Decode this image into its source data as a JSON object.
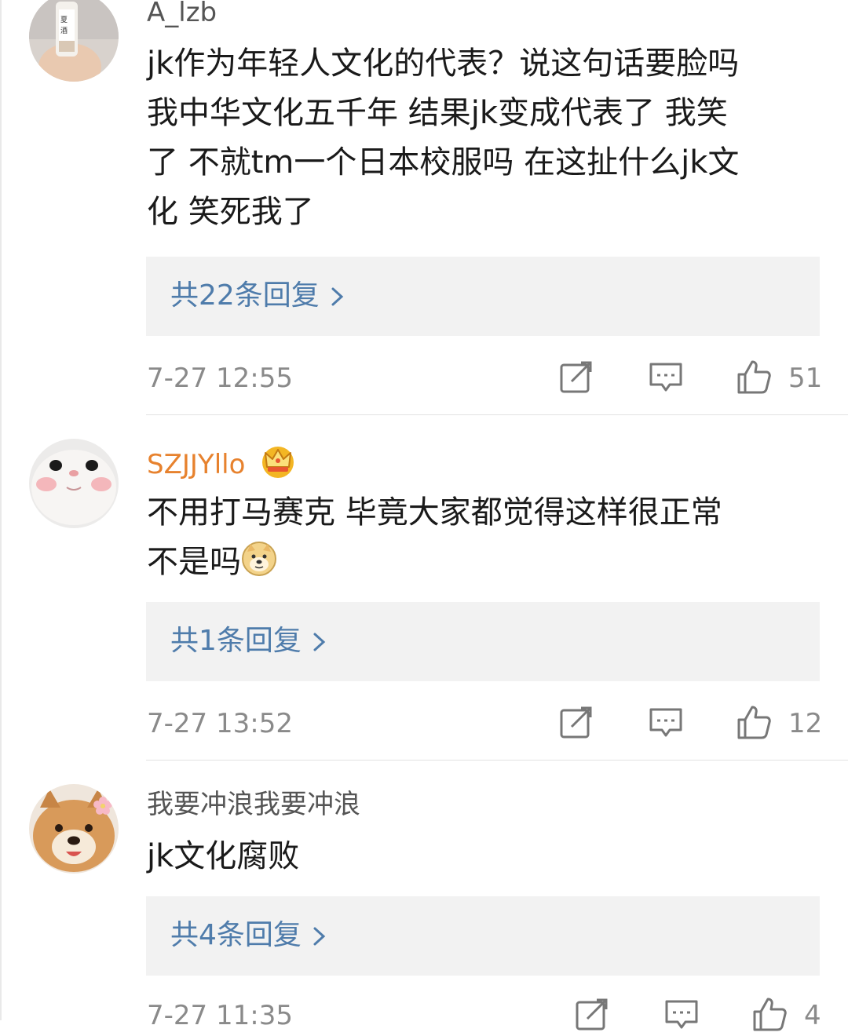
{
  "comments": [
    {
      "username": "A_lzb",
      "lines": [
        "jk作为年轻人文化的代表？说这句话要脸吗",
        "我中华文化五千年 结果jk变成代表了 我笑",
        "了 不就tm一个日本校服吗 在这扯什么jk文",
        "化 笑死我了"
      ],
      "replies": "共22条回复",
      "time": "7-27 12:55",
      "likes": "51"
    },
    {
      "username": "SZJJYllo",
      "vip_badge": "crown-icon",
      "lines": [
        "不用打马赛克 毕竟大家都觉得这样很正常",
        "不是吗"
      ],
      "emoji": "doge-emoji",
      "replies": "共1条回复",
      "time": "7-27 13:52",
      "likes": "12"
    },
    {
      "username": "我要冲浪我要冲浪",
      "lines": [
        "jk文化腐败"
      ],
      "replies": "共4条回复",
      "time": "7-27 11:35",
      "likes": "4"
    }
  ],
  "colors": {
    "vip_name": "#e7822e",
    "reply_link": "#4f7cab",
    "reply_bg": "#f2f2f2",
    "meta": "#8a8a8a"
  }
}
